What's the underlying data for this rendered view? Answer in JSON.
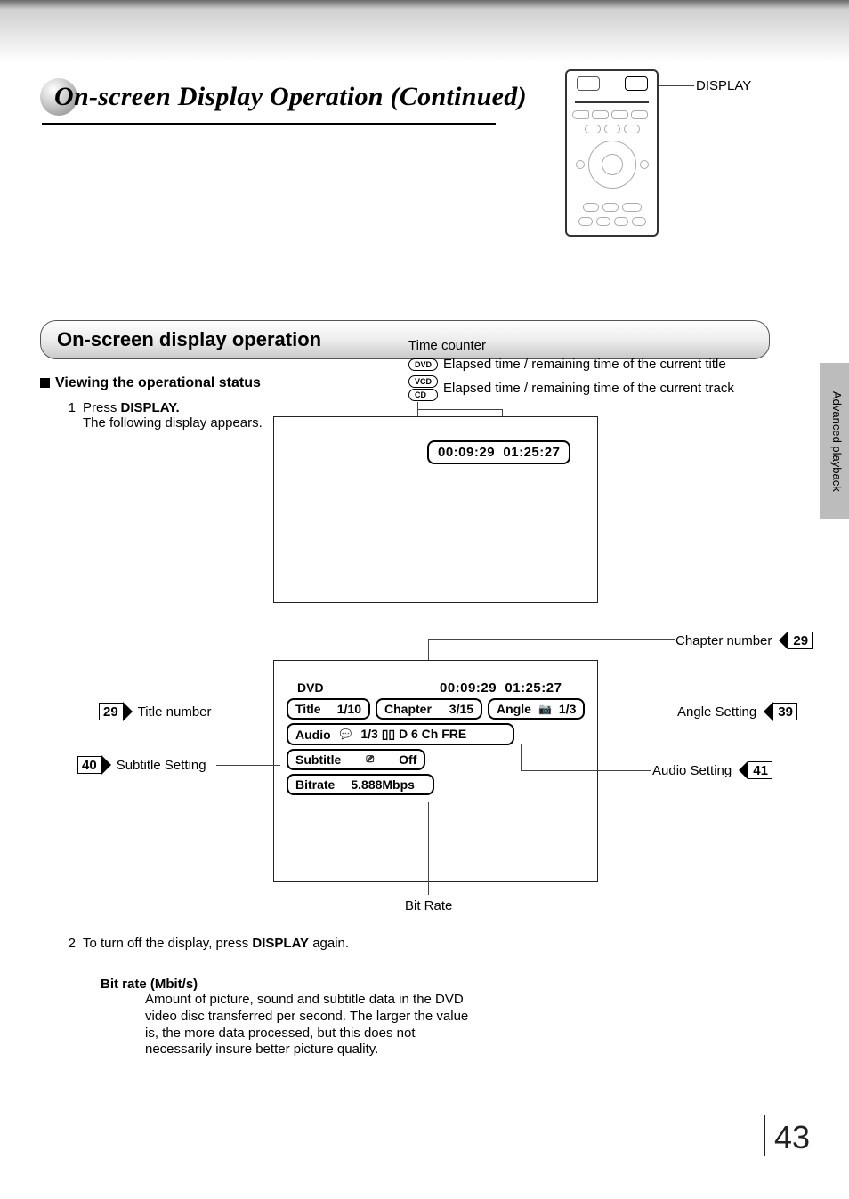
{
  "header": {
    "page_title": "On-screen Display Operation (Continued)",
    "remote_label": "DISPLAY"
  },
  "side_tab": "Advanced playback",
  "page_number": "43",
  "section_bar": "On-screen display operation",
  "subheading": "Viewing the operational status",
  "step1": {
    "num": "1",
    "prefix": "Press ",
    "button": "DISPLAY.",
    "line2": "The following display appears."
  },
  "time_counter": {
    "title": "Time counter",
    "dvd_icon": "DVD",
    "dvd_line": "Elapsed time / remaining time of the current title",
    "vcd_icon_top": "VCD",
    "vcd_icon_bottom": "CD",
    "vcd_line": "Elapsed time / remaining time of the current track"
  },
  "osd1": {
    "elapsed": "00:09:29",
    "total": "01:25:27"
  },
  "osd2": {
    "disc": "DVD",
    "elapsed": "00:09:29",
    "total": "01:25:27",
    "title_label": "Title",
    "title_value": "1/10",
    "chapter_label": "Chapter",
    "chapter_value": "3/15",
    "angle_label": "Angle",
    "angle_value": "1/3",
    "audio_label": "Audio",
    "audio_value": "1/3 ▯▯ D 6 Ch FRE",
    "subtitle_label": "Subtitle",
    "subtitle_value": "Off",
    "bitrate_label": "Bitrate",
    "bitrate_value": "5.888Mbps"
  },
  "callouts": {
    "title_number": {
      "label": "Title number",
      "page": "29"
    },
    "subtitle_setting": {
      "label": "Subtitle Setting",
      "page": "40"
    },
    "chapter_number": {
      "label": "Chapter number",
      "page": "29"
    },
    "angle_setting": {
      "label": "Angle Setting",
      "page": "39"
    },
    "audio_setting": {
      "label": "Audio Setting",
      "page": "41"
    },
    "bit_rate": "Bit Rate"
  },
  "step2": {
    "num": "2",
    "prefix": "To turn off the display, press ",
    "button": "DISPLAY",
    "suffix": " again."
  },
  "bitrate_note": {
    "heading": "Bit rate (Mbit/s)",
    "body": "Amount of picture, sound and subtitle data in the DVD video disc transferred per second. The larger the value is, the more data processed, but this does not necessarily insure better picture quality."
  }
}
